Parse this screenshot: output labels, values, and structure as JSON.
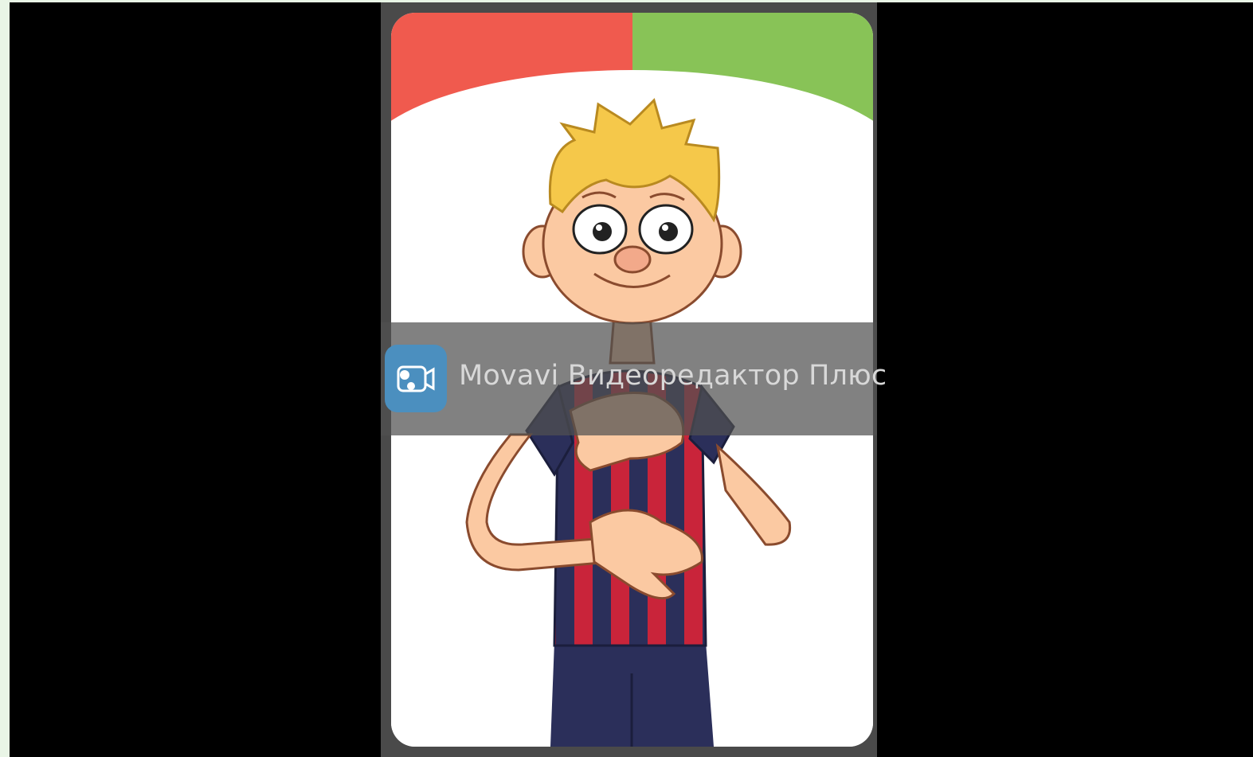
{
  "colors": {
    "background": "#e9f5e6",
    "frame": "#000000",
    "card_border": "#4a4a4a",
    "card_red": "#f05a4e",
    "card_green": "#88c357",
    "shirt_red": "#c9243a",
    "shirt_navy": "#2b2f5a"
  },
  "card": {
    "illustration": "cartoon boy in red-and-navy striped shirt with right hand on chest and left hand on stomach"
  },
  "watermark": {
    "icon": "movavi-camera-icon",
    "text": "Movavi Видеоредактор Плюс"
  }
}
